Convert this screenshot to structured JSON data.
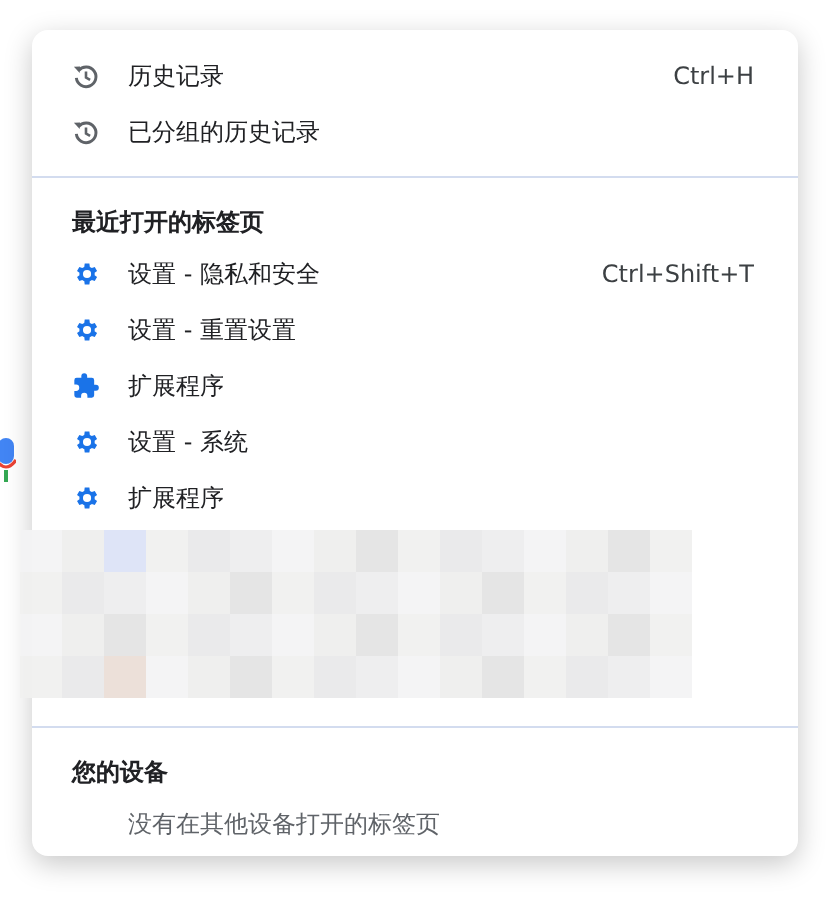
{
  "history_items": [
    {
      "label": "历史记录",
      "shortcut": "Ctrl+H"
    },
    {
      "label": "已分组的历史记录"
    }
  ],
  "recent_tabs": {
    "title": "最近打开的标签页",
    "items": [
      {
        "label": "设置 - 隐私和安全",
        "kind": "settings",
        "shortcut": "Ctrl+Shift+T"
      },
      {
        "label": "设置 - 重置设置",
        "kind": "settings"
      },
      {
        "label": "扩展程序",
        "kind": "extensions"
      },
      {
        "label": "设置 - 系统",
        "kind": "settings"
      },
      {
        "label": "扩展程序",
        "kind": "settings"
      }
    ]
  },
  "your_devices": {
    "title": "您的设备",
    "message": "没有在其他设备打开的标签页"
  }
}
